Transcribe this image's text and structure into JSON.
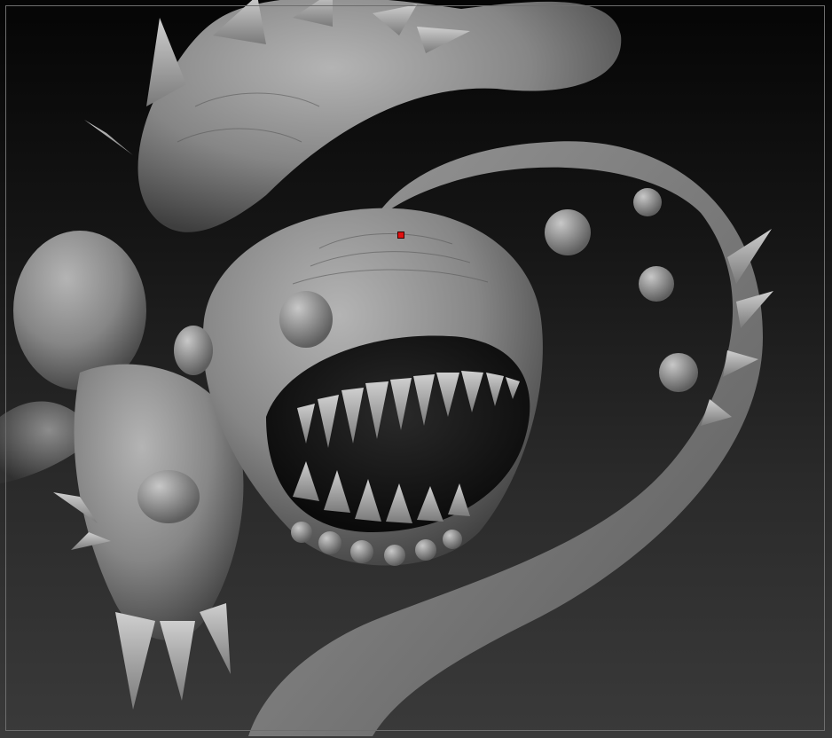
{
  "canvas": {
    "background_top": "#050505",
    "background_bottom": "#3a3a3a",
    "frame_color": "#6e6e6e"
  },
  "model": {
    "subject": "sculpt-creature",
    "material_color": "#8e8e8e",
    "shadow_color": "#1a1a1a"
  },
  "pivot_marker": {
    "color": "#e01010"
  }
}
